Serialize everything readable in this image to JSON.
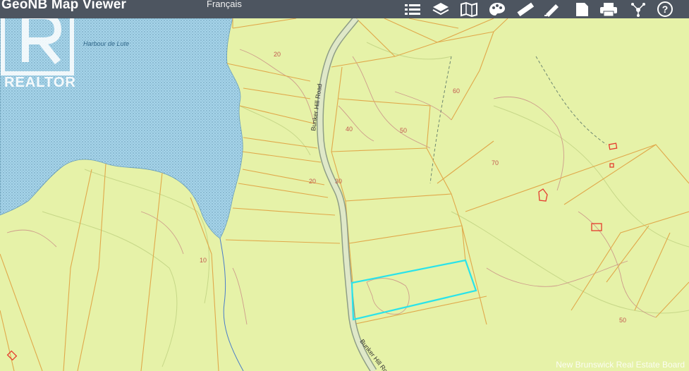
{
  "app": {
    "title": "GeoNB Map Viewer",
    "language_link": "Français"
  },
  "toolbar": {
    "tools": [
      {
        "icon": "list-icon"
      },
      {
        "icon": "layers-icon"
      },
      {
        "icon": "basemap-icon"
      },
      {
        "icon": "palette-icon"
      },
      {
        "icon": "ruler-icon"
      },
      {
        "icon": "draw-icon"
      },
      {
        "icon": "document-icon"
      },
      {
        "icon": "print-icon"
      },
      {
        "icon": "share-icon"
      },
      {
        "icon": "help-icon"
      }
    ]
  },
  "watermark": {
    "logo_text": "REALTOR",
    "credit": "New Brunswick Real Estate Board"
  },
  "map": {
    "water_label": "Harbour de Lute",
    "road_labels": [
      "Bunker Hill Road",
      "Bunker Hill Road"
    ],
    "contour_labels": [
      "20",
      "40",
      "50",
      "60",
      "70",
      "20",
      "30",
      "10",
      "50"
    ],
    "colors": {
      "land": "#e6f2a8",
      "water": "#a6d4ea",
      "parcel": "#e0a84a",
      "highlight": "#29e3ea",
      "building": "#e53b2e",
      "contour": "#c98e86"
    }
  }
}
